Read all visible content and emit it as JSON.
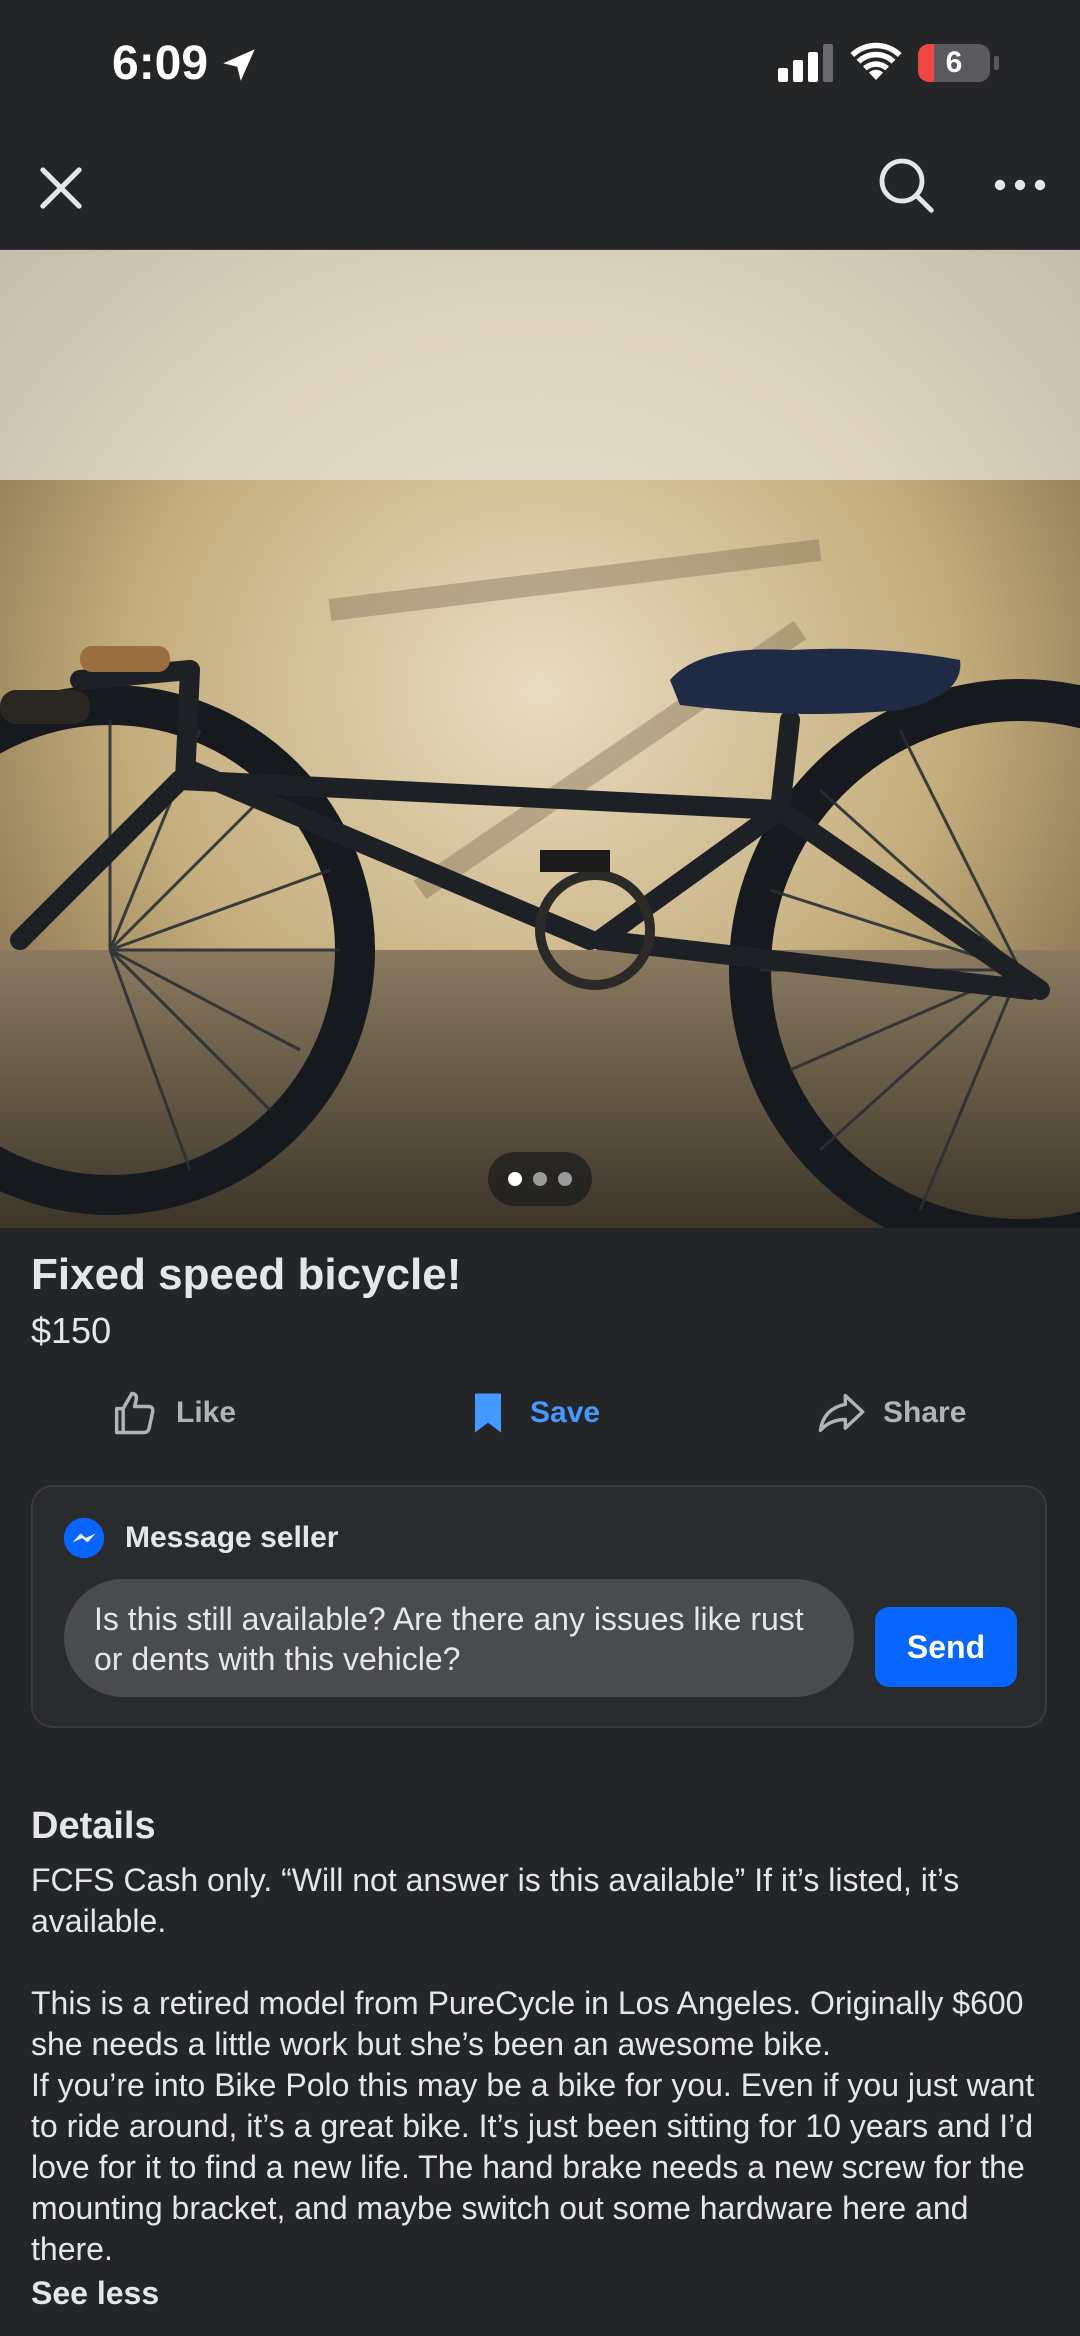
{
  "status_bar": {
    "time": "6:09",
    "battery_level": "6",
    "battery_fraction": 0.06,
    "colors": {
      "battery_low": "#ef4545"
    },
    "icons": [
      "location-arrow-icon",
      "cellular-signal-icon",
      "wifi-icon",
      "battery-icon"
    ]
  },
  "nav": {
    "icons": [
      "close-icon",
      "search-icon",
      "more-icon"
    ]
  },
  "photo": {
    "pager": {
      "count": 3,
      "active_index": 0
    }
  },
  "listing": {
    "title": "Fixed speed bicycle!",
    "price": "$150"
  },
  "actions": {
    "like": "Like",
    "save": "Save",
    "share": "Share",
    "colors": {
      "save_active": "#4599ff",
      "inactive": "#b0b3b8"
    }
  },
  "message_seller": {
    "heading": "Message seller",
    "draft": "Is this still available? Are there any issues like rust or dents with this vehicle?",
    "send_label": "Send",
    "colors": {
      "send_button": "#0866ff",
      "messenger_icon": "#0866ff"
    }
  },
  "details": {
    "heading": "Details",
    "paragraph_1": "FCFS Cash only. “Will not answer is this available” If it’s listed, it’s available.",
    "paragraph_2": "This is a retired model from PureCycle in Los Angeles. Originally $600 she needs a little work but she’s been an awesome bike.\nIf you’re into Bike Polo this may be a bike for you. Even if you just want to ride around, it’s a great bike. It’s just been sitting for 10 years and I’d love for it to find a new life. The hand brake needs a new screw for the mounting bracket, and maybe switch out some hardware here and there.",
    "see_less": "See less"
  }
}
